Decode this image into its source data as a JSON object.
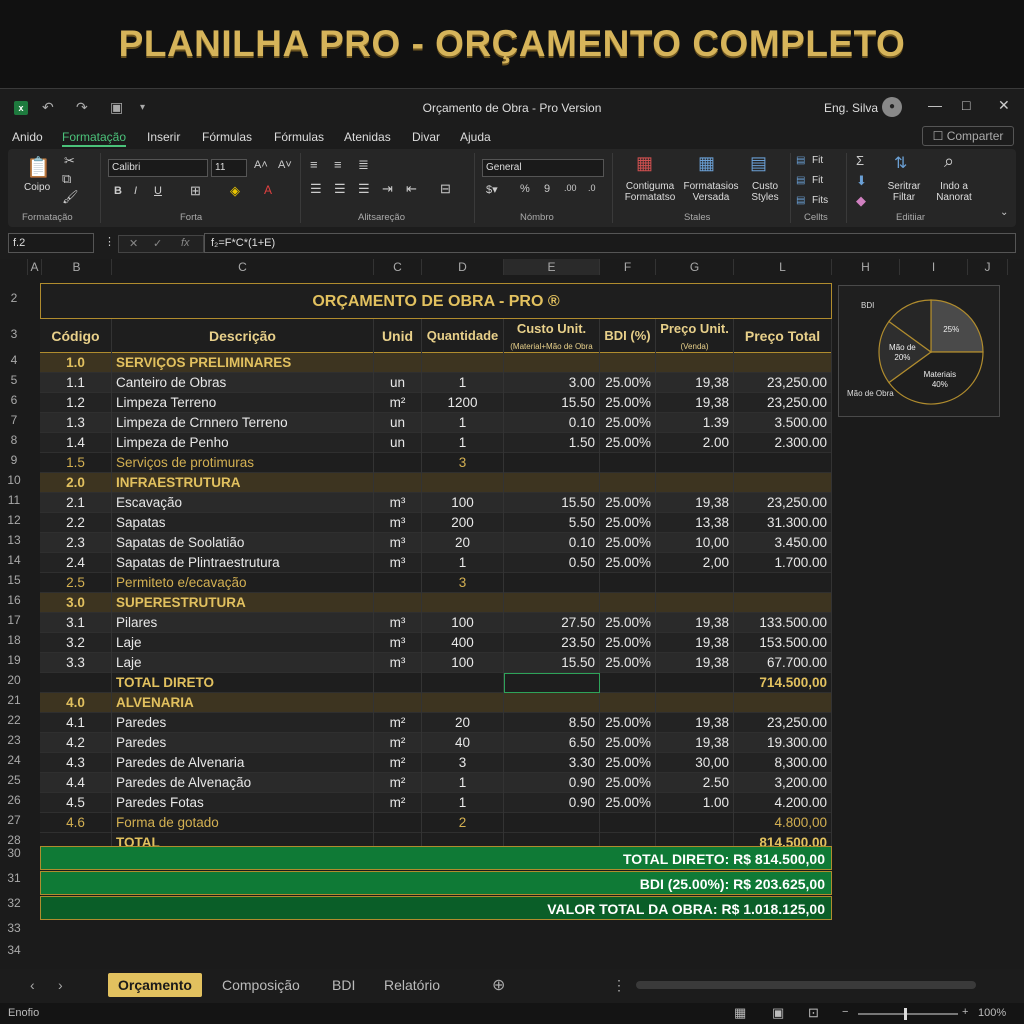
{
  "banner_title": "PLANILHA PRO - ORÇAMENTO COMPLETO",
  "window": {
    "title": "Orçamento de Obra  - Pro Version",
    "user": "Eng. Silva"
  },
  "menu": [
    "Anido",
    "Formatação",
    "Inserir",
    "Fórmulas",
    "Fórmulas",
    "Atenidas",
    "Divar",
    "Ajuda"
  ],
  "share_label": "Comparter",
  "ribbon": {
    "paste": "Coipo",
    "font_name": "Calibri",
    "font_size": "11",
    "number_format": "General",
    "cond_fmt": "Contiguma Formatatso",
    "fmt_table": "Formatasios Versada",
    "cell_styles": "Custo Styles",
    "fit1": "Fit",
    "fit2": "Fit",
    "fit3": "Fits",
    "sort": "Seritrar Filtar",
    "find": "Indo a Nanorat",
    "groups": {
      "clipboard": "Formatação",
      "font": "Forta",
      "align": "Alitsareção",
      "number": "Nómbro",
      "styles": "Stales",
      "cells": "Cellts",
      "edit": "Editiiar"
    }
  },
  "formula": {
    "namebox": "f.2",
    "input": "f₂=F*C*(1+E)"
  },
  "columns": [
    "A",
    "B",
    "C",
    "C",
    "D",
    "E",
    "F",
    "G",
    "L",
    "H",
    "I",
    "J"
  ],
  "rownums": [
    "2",
    "3",
    "4",
    "5",
    "6",
    "7",
    "8",
    "9",
    "10",
    "11",
    "12",
    "13",
    "14",
    "15",
    "16",
    "17",
    "18",
    "19",
    "20",
    "21",
    "22",
    "23",
    "24",
    "25",
    "26",
    "27",
    "28",
    "30",
    "31",
    "32",
    "33",
    "34"
  ],
  "sheet": {
    "title": "ORÇAMENTO DE OBRA - PRO ®",
    "headers": [
      "Código",
      "Descrição",
      "Unid",
      "Quantidade",
      "Custo Unit.",
      "BDI (%)",
      "Preço Unit.",
      "Preço Total"
    ],
    "header_sub": {
      "custo": "(Material+Mão de Obra",
      "preco": "(Venda)"
    },
    "rows": [
      {
        "t": "sect",
        "v": [
          "1.0",
          "SERVIÇOS PRELIMINARES",
          "",
          "",
          "",
          "",
          "",
          ""
        ]
      },
      {
        "t": "d",
        "v": [
          "1.1",
          "Canteiro de Obras",
          "un",
          "1",
          "3.00",
          "25.00%",
          "19,38",
          "23,250.00"
        ]
      },
      {
        "t": "d",
        "v": [
          "1.2",
          "Limpeza Terreno",
          "m²",
          "1200",
          "15.50",
          "25.00%",
          "19,38",
          "23,250.00"
        ]
      },
      {
        "t": "d",
        "v": [
          "1.3",
          "Limpeza de Crnnero Terreno",
          "un",
          "1",
          "0.10",
          "25.00%",
          "1.39",
          "3.500.00"
        ]
      },
      {
        "t": "d",
        "v": [
          "1.4",
          "Limpeza de Penho",
          "un",
          "1",
          "1.50",
          "25.00%",
          "2.00",
          "2.300.00"
        ]
      },
      {
        "t": "sub",
        "v": [
          "1.5",
          "Serviços de protimuras",
          "",
          "3",
          "",
          "",
          "",
          ""
        ]
      },
      {
        "t": "sect",
        "v": [
          "2.0",
          "INFRAESTRUTURA",
          "",
          "",
          "",
          "",
          "",
          ""
        ]
      },
      {
        "t": "d",
        "v": [
          "2.1",
          "Escavação",
          "m³",
          "100",
          "15.50",
          "25.00%",
          "19,38",
          "23,250.00"
        ]
      },
      {
        "t": "d",
        "v": [
          "2.2",
          "Sapatas",
          "m³",
          "200",
          "5.50",
          "25.00%",
          "13,38",
          "31.300.00"
        ]
      },
      {
        "t": "d",
        "v": [
          "2.3",
          "Sapatas de Soolatião",
          "m³",
          "20",
          "0.10",
          "25.00%",
          "10,00",
          "3.450.00"
        ]
      },
      {
        "t": "d",
        "v": [
          "2.4",
          "Sapatas de Plintraestrutura",
          "m³",
          "1",
          "0.50",
          "25.00%",
          "2,00",
          "1.700.00"
        ]
      },
      {
        "t": "sub",
        "v": [
          "2.5",
          "Permiteto e/ecavação",
          "",
          "3",
          "",
          "",
          "",
          ""
        ]
      },
      {
        "t": "sect",
        "v": [
          "3.0",
          "SUPERESTRUTURA",
          "",
          "",
          "",
          "",
          "",
          ""
        ]
      },
      {
        "t": "d",
        "v": [
          "3.1",
          "Pilares",
          "m³",
          "100",
          "27.50",
          "25.00%",
          "19,38",
          "133.500.00"
        ]
      },
      {
        "t": "d",
        "v": [
          "3.2",
          "Laje",
          "m³",
          "400",
          "23.50",
          "25.00%",
          "19,38",
          "153.500.00"
        ]
      },
      {
        "t": "d",
        "v": [
          "3.3",
          "Laje",
          "m³",
          "100",
          "15.50",
          "25.00%",
          "19,38",
          "67.700.00"
        ]
      },
      {
        "t": "tot",
        "v": [
          "",
          "TOTAL DIRETO",
          "",
          "",
          "",
          "",
          "",
          "714.500,00"
        ]
      },
      {
        "t": "sect",
        "v": [
          "4.0",
          "ALVENARIA",
          "",
          "",
          "",
          "",
          "",
          ""
        ]
      },
      {
        "t": "d",
        "v": [
          "4.1",
          "Paredes",
          "m²",
          "20",
          "8.50",
          "25.00%",
          "19,38",
          "23,250.00"
        ]
      },
      {
        "t": "d",
        "v": [
          "4.2",
          "Paredes",
          "m²",
          "40",
          "6.50",
          "25.00%",
          "19,38",
          "19.300.00"
        ]
      },
      {
        "t": "d",
        "v": [
          "4.3",
          "Paredes de Alvenaria",
          "m²",
          "3",
          "3.30",
          "25.00%",
          "30,00",
          "8,300.00"
        ]
      },
      {
        "t": "d",
        "v": [
          "4.4",
          "Paredes de Alvenação",
          "m²",
          "1",
          "0.90",
          "25.00%",
          "2.50",
          "3,200.00"
        ]
      },
      {
        "t": "d",
        "v": [
          "4.5",
          "Paredes Fotas",
          "m²",
          "1",
          "0.90",
          "25.00%",
          "1.00",
          "4.200.00"
        ]
      },
      {
        "t": "sub",
        "v": [
          "4.6",
          "Forma de gotado",
          "",
          "2",
          "",
          "",
          "",
          "4.800,00"
        ]
      },
      {
        "t": "tot",
        "v": [
          "",
          "TOTAL",
          "",
          "",
          "",
          "",
          "",
          "814.500,00"
        ]
      }
    ],
    "summary": [
      "TOTAL DIRETO:   R$ 814.500,00",
      "BDI (25.00%):   R$ 203.625,00",
      "VALOR TOTAL DA OBRA: R$ 1.018.125,00"
    ]
  },
  "chart_data": {
    "type": "pie",
    "title": "BDI",
    "slices": [
      {
        "label": "25%",
        "value": 25,
        "color": "#4a4a4a"
      },
      {
        "label": "Materiais 40%",
        "value": 40,
        "color": "#1e1e1e"
      },
      {
        "label": "Mão de 20%",
        "value": 20,
        "color": "#2e2e2e"
      },
      {
        "label": "",
        "value": 15,
        "color": "#262626"
      }
    ],
    "outside_label": "Mão de Obra"
  },
  "tabs": [
    "Orçamento",
    "Composição",
    "BDI",
    "Relatório"
  ],
  "status": {
    "left": "Enofio",
    "zoom": "100%"
  }
}
